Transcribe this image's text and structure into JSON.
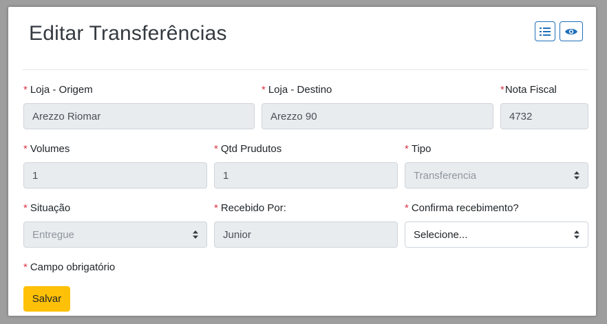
{
  "header": {
    "title": "Editar Transferências"
  },
  "toolbar": {
    "list_icon": "list-icon",
    "view_icon": "eye-icon",
    "accent": "#1f6fb8"
  },
  "fields": {
    "loja_origem": {
      "label": "Loja - Origem",
      "value": "Arezzo Riomar"
    },
    "loja_destino": {
      "label": "Loja - Destino",
      "value": "Arezzo 90"
    },
    "nota_fiscal": {
      "label": "Nota Fiscal",
      "value": "4732"
    },
    "volumes": {
      "label": "Volumes",
      "value": "1"
    },
    "qtd_produtos": {
      "label": "Qtd Prudutos",
      "value": "1"
    },
    "tipo": {
      "label": "Tipo",
      "value": "Transferencia"
    },
    "situacao": {
      "label": "Situação",
      "value": "Entregue"
    },
    "recebido_por": {
      "label": "Recebido Por:",
      "value": "Junior"
    },
    "confirma_recebimento": {
      "label": "Confirma recebimento?",
      "value": "Selecione..."
    }
  },
  "required_mark": "*",
  "footnote": "Campo obrigatório",
  "actions": {
    "save_label": "Salvar",
    "save_color": "#ffc107"
  },
  "colors": {
    "required": "#dc3545",
    "readonly_bg": "#e9ecef"
  }
}
